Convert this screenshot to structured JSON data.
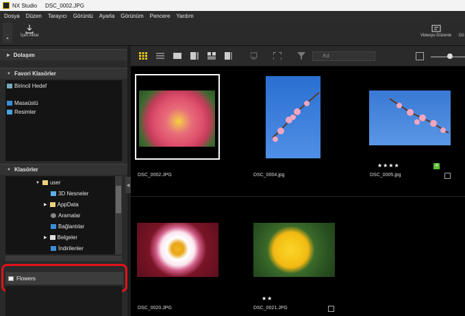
{
  "window": {
    "app": "NX Studio",
    "file": "DSC_0002.JPG"
  },
  "menu": [
    "Dosya",
    "Düzen",
    "Tarayıcı",
    "Görüntü",
    "Ayarla",
    "Görünüm",
    "Pencere",
    "Yardım"
  ],
  "toolbar": {
    "import_label": "İçeri Aktar",
    "video_label": "Videoyu Düzenle",
    "video_label_cut": "Dü"
  },
  "sidebar": {
    "navigation": "Dolaşım",
    "favorites": "Favori Klasörler",
    "fav_items": [
      "Birincil Hedef",
      "Masaüstü",
      "Resimler"
    ],
    "folders": "Klasörler",
    "tree": [
      "user",
      "3D Nesneler",
      "AppData",
      "Aramalar",
      "Bağlantılar",
      "Belgeler",
      "İndirilenler"
    ],
    "album": "Flowers"
  },
  "main_toolbar": {
    "sort_label": "Ad"
  },
  "thumbnails": [
    {
      "name": "DSC_0002.JPG",
      "stars": "",
      "selected": true
    },
    {
      "name": "DSC_0004.jpg",
      "stars": ""
    },
    {
      "name": "DSC_0005.jpg",
      "stars": "★★★★",
      "badge": "4"
    },
    {
      "name": "DSC_0020.JPG",
      "stars": ""
    },
    {
      "name": "DSC_0021.JPG",
      "stars": "★★"
    }
  ]
}
